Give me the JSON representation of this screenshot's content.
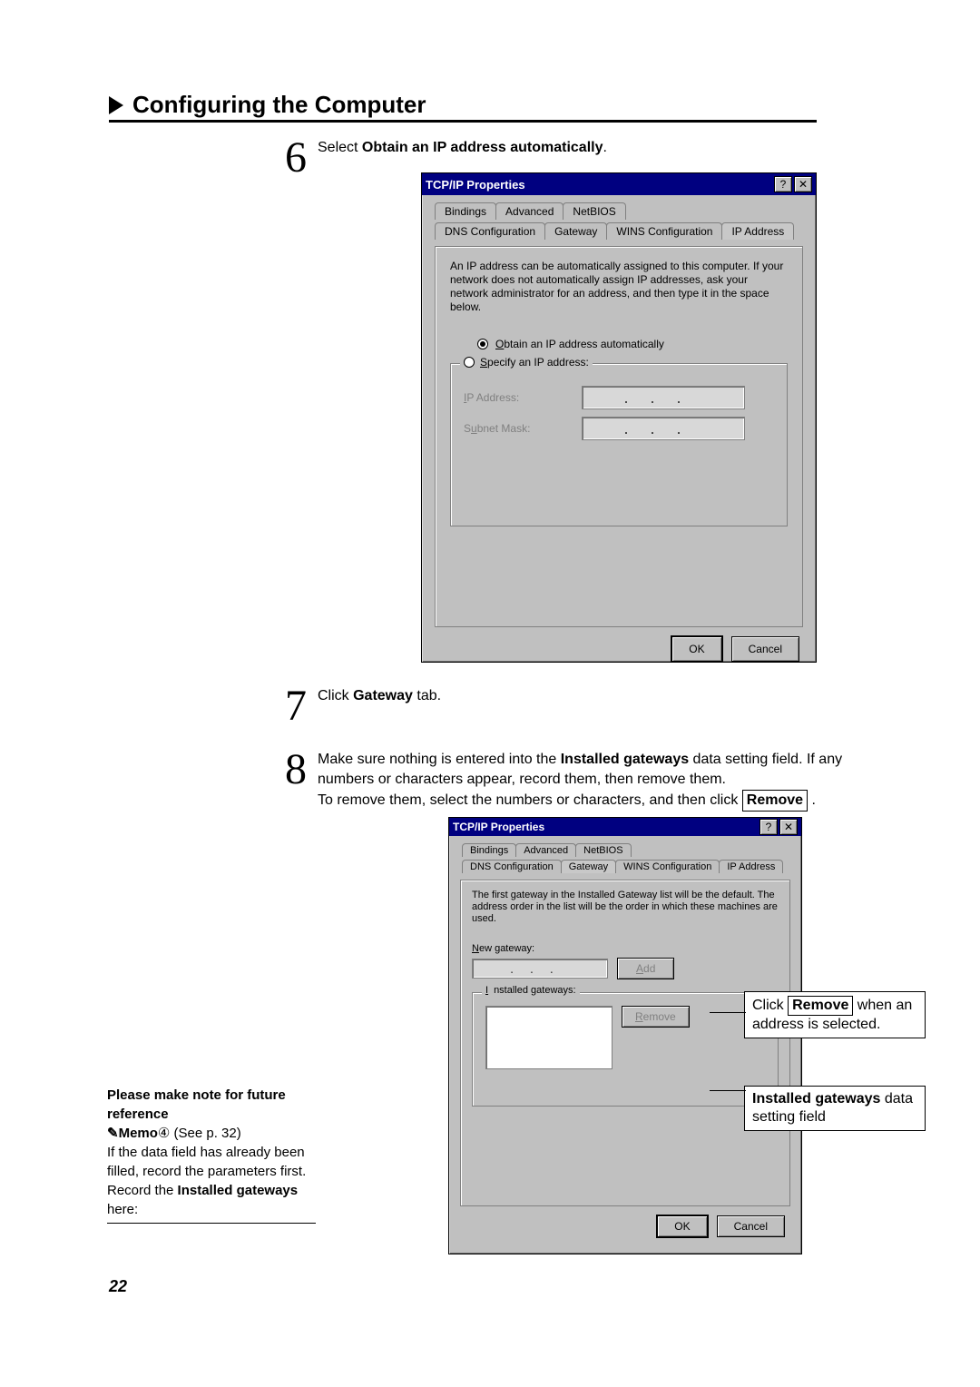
{
  "title": "Configuring the Computer",
  "step6": {
    "num": "6",
    "text_before": "Select ",
    "bold": "Obtain an IP address automatically",
    "text_after": "."
  },
  "dlg1": {
    "title": "TCP/IP Properties",
    "help": "?",
    "close": "✕",
    "tabs_row1": [
      "Bindings",
      "Advanced",
      "NetBIOS"
    ],
    "tabs_row2": [
      "DNS Configuration",
      "Gateway",
      "WINS Configuration",
      "IP Address"
    ],
    "info": "An IP address can be automatically assigned to this computer. If your network does not automatically assign IP addresses, ask your network administrator for an address, and then type it in the space below.",
    "radio_auto": "Obtain an IP address automatically",
    "radio_spec": "Specify an IP address:",
    "ip_label": "IP Address:",
    "mask_label": "Subnet Mask:",
    "dots": "...",
    "ok": "OK",
    "cancel": "Cancel"
  },
  "step7": {
    "num": "7",
    "text_before": "Click ",
    "bold": "Gateway",
    "text_after": " tab."
  },
  "step8": {
    "num": "8",
    "line1a": "Make sure nothing is entered into the ",
    "line1b": "Installed gateways",
    "line1c": " data setting field. If any numbers or characters appear, record them, then remove them.",
    "line2a": "To remove them, select the numbers or characters, and then click ",
    "remove_btn": "Remove",
    "line2b": " ."
  },
  "dlg2": {
    "title": "TCP/IP Properties",
    "help": "?",
    "close": "✕",
    "tabs_row1": [
      "Bindings",
      "Advanced",
      "NetBIOS"
    ],
    "tabs_row2": [
      "DNS Configuration",
      "Gateway",
      "WINS Configuration",
      "IP Address"
    ],
    "info": "The first gateway in the Installed Gateway list will be the default. The address order in the list will be the order in which these machines are used.",
    "new_gw": "New gateway:",
    "add": "Add",
    "installed": "Installed gateways:",
    "remove": "Remove",
    "ok": "OK",
    "cancel": "Cancel",
    "dots": "..."
  },
  "sidenote": {
    "heading": "Please make note for future reference",
    "memo_a": "✎Memo",
    "memo_circle": "④",
    "memo_b": " (See p. 32)",
    "body1": "If the data field has already been filled, record the parameters first.",
    "rec_a": "Record the ",
    "rec_b": "Installed gateways",
    "rec_c": " here:"
  },
  "callout1": {
    "a": "Click ",
    "btn": "Remove",
    "b": " when an address is selected."
  },
  "callout2": {
    "a": "Installed gateways",
    "b": " data setting field"
  },
  "page": "22"
}
